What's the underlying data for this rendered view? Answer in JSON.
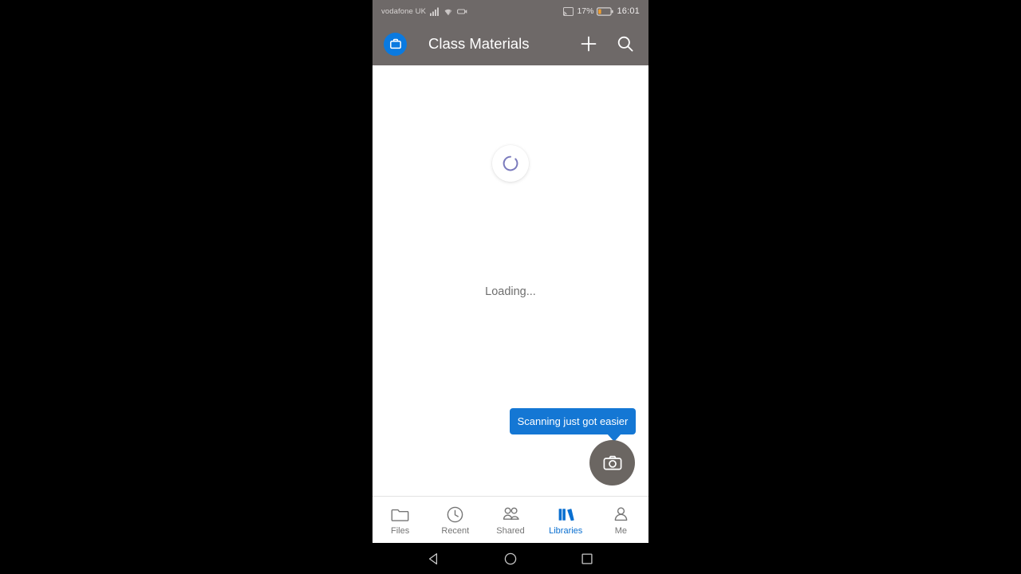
{
  "status_bar": {
    "carrier": "vodafone UK",
    "battery_percent": "17%",
    "time": "16:01",
    "icons": [
      "signal-bars-icon",
      "wifi-icon",
      "data-saver-icon",
      "cast-icon",
      "battery-icon"
    ],
    "battery_fill_color": "#f29f2e",
    "background_color": "#6e6968"
  },
  "app_bar": {
    "title": "Class Materials",
    "badge_icon": "briefcase-icon",
    "badge_color": "#0a7ae0",
    "add_label": "+",
    "actions": [
      "add-icon",
      "search-icon"
    ],
    "background_color": "#6e6968"
  },
  "content": {
    "loading_text": "Loading...",
    "spinner_icon": "loading-spinner-icon",
    "spinner_color": "#7b7bbd"
  },
  "tooltip": {
    "text": "Scanning just got easier",
    "background_color": "#1477d4"
  },
  "fab": {
    "icon": "camera-icon",
    "background_color": "#6b6662"
  },
  "bottom_nav": {
    "active_color": "#0a6fd0",
    "inactive_color": "#757575",
    "items": [
      {
        "label": "Files",
        "icon": "folder-icon",
        "active": false
      },
      {
        "label": "Recent",
        "icon": "clock-icon",
        "active": false
      },
      {
        "label": "Shared",
        "icon": "people-icon",
        "active": false
      },
      {
        "label": "Libraries",
        "icon": "books-icon",
        "active": true
      },
      {
        "label": "Me",
        "icon": "person-icon",
        "active": false
      }
    ]
  },
  "system_nav": {
    "buttons": [
      {
        "name": "back",
        "icon": "triangle-back-icon"
      },
      {
        "name": "home",
        "icon": "circle-home-icon"
      },
      {
        "name": "recents",
        "icon": "square-recents-icon"
      }
    ]
  }
}
